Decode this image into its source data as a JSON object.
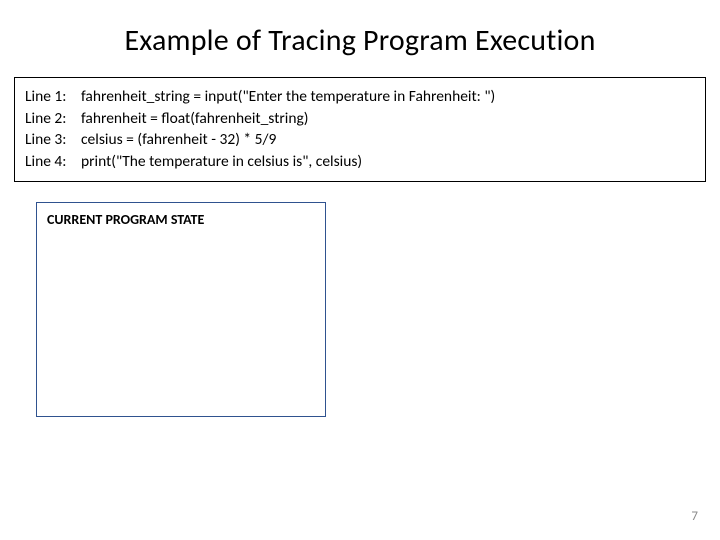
{
  "title": "Example of Tracing Program Execution",
  "code": {
    "lines": [
      {
        "label": "Line 1:",
        "text": "fahrenheit_string = input(\"Enter the temperature in Fahrenheit: \")"
      },
      {
        "label": "Line 2:",
        "text": "fahrenheit = float(fahrenheit_string)"
      },
      {
        "label": "Line 3:",
        "text": "celsius = (fahrenheit - 32) * 5/9"
      },
      {
        "label": "Line 4:",
        "text": "print(\"The temperature in celsius is\", celsius)"
      }
    ]
  },
  "state_box": {
    "title": "CURRENT PROGRAM STATE"
  },
  "page_number": "7"
}
